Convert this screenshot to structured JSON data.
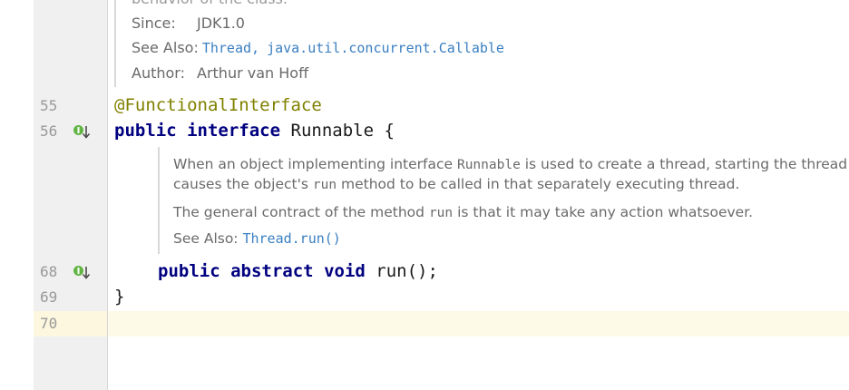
{
  "header_doc": {
    "cut_text": "behavior of the class.",
    "since_label": "Since:",
    "since_value": "JDK1.0",
    "see_also_label": "See Also:",
    "see_also_link1": "Thread,",
    "see_also_link2": "java.util.concurrent.Callable",
    "author_label": "Author:",
    "author_value": "Arthur van Hoff"
  },
  "lines": {
    "l55": "55",
    "l56": "56",
    "l68": "68",
    "l69": "69",
    "l70": "70"
  },
  "code": {
    "annotation": "@FunctionalInterface",
    "kw_public": "public",
    "kw_interface": "interface",
    "class_name": "Runnable",
    "open_brace": "{",
    "kw_public2": "public",
    "kw_abstract": "abstract",
    "kw_void": "void",
    "method_sig": "run();",
    "close_brace": "}"
  },
  "method_doc": {
    "p1_a": "When an object implementing interface",
    "p1_code": "Runnable",
    "p1_b": "is used to create a thread, starting the thread",
    "p2_a": "causes the object's",
    "p2_code": "run",
    "p2_b": "method to be called in that separately executing thread.",
    "p3_a": "The general contract of the method",
    "p3_code": "run",
    "p3_b": "is that it may take any action whatsoever.",
    "see_also_label": "See Also:",
    "see_also_link": "Thread.run()"
  },
  "icons": {
    "gutter_icon": "implemented-by-down-arrow-icon",
    "icon_green": "#62b543",
    "link_color": "#3a7fc1",
    "keyword_color": "#000080",
    "annotation_color": "#808000",
    "current_line_color": "#fefae8"
  }
}
